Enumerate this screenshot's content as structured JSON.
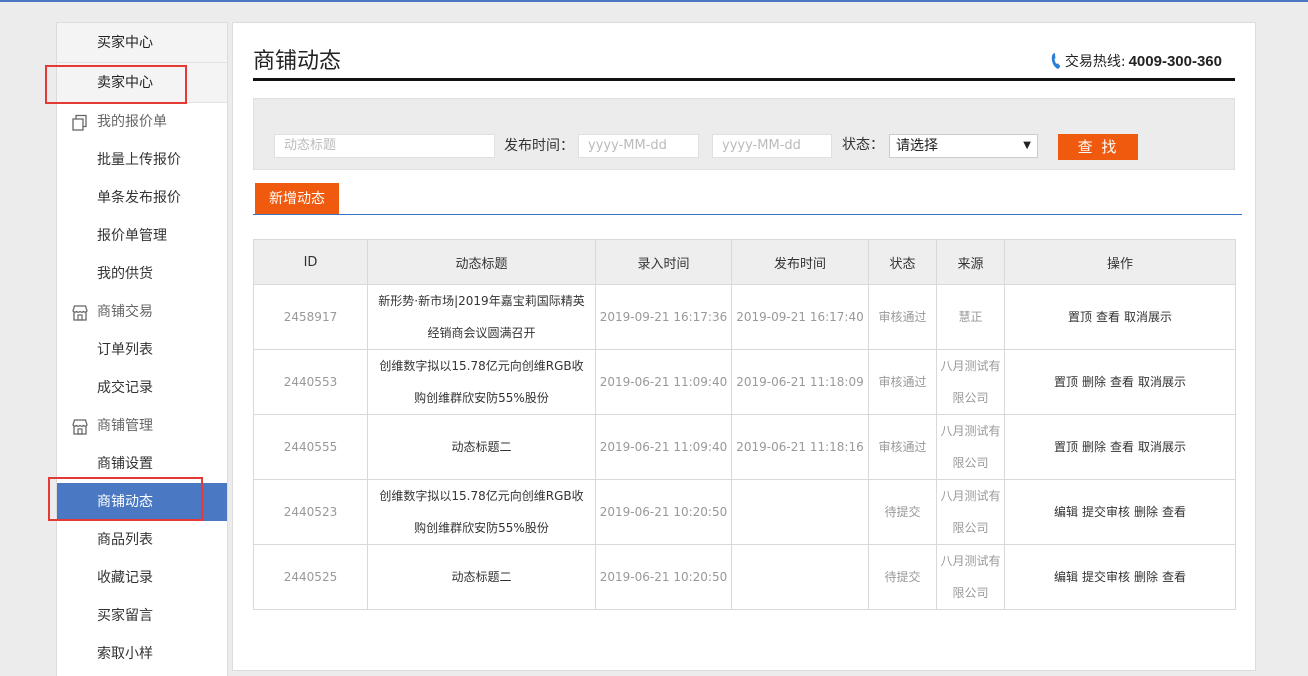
{
  "sidebar": {
    "buyer_center": "买家中心",
    "seller_center": "卖家中心",
    "groups": [
      {
        "label": "我的报价单",
        "icon": "copy-icon",
        "items": [
          "批量上传报价",
          "单条发布报价",
          "报价单管理",
          "我的供货"
        ]
      },
      {
        "label": "商铺交易",
        "icon": "shop-icon",
        "items": [
          "订单列表",
          "成交记录"
        ]
      },
      {
        "label": "商铺管理",
        "icon": "shop-icon",
        "items": [
          "商铺设置",
          "商铺动态",
          "商品列表",
          "收藏记录",
          "买家留言",
          "索取小样"
        ]
      }
    ],
    "active_item": "商铺动态"
  },
  "header": {
    "title": "商铺动态",
    "hotline_label": "交易热线:",
    "hotline_number": "4009-300-360"
  },
  "search": {
    "title_placeholder": "动态标题",
    "publish_time_label": "发布时间：",
    "date_from_placeholder": "yyyy-MM-dd",
    "date_to_placeholder": "yyyy-MM-dd",
    "status_label": "状态：",
    "status_value": "请选择",
    "search_button": "查 找"
  },
  "add_button": "新增动态",
  "table": {
    "headers": [
      "ID",
      "动态标题",
      "录入时间",
      "发布时间",
      "状态",
      "来源",
      "操作"
    ],
    "rows": [
      {
        "id": "2458917",
        "title": "新形势·新市场|2019年嘉宝莉国际精英经销商会议圆满召开",
        "entered": "2019-09-21 16:17:36",
        "published": "2019-09-21 16:17:40",
        "status": "审核通过",
        "source": "慧正",
        "ops": [
          "置顶",
          "查看",
          "取消展示"
        ]
      },
      {
        "id": "2440553",
        "title": "创维数字拟以15.78亿元向创维RGB收购创维群欣安防55%股份",
        "entered": "2019-06-21 11:09:40",
        "published": "2019-06-21 11:18:09",
        "status": "审核通过",
        "source": "八月测试有限公司",
        "ops": [
          "置顶",
          "删除",
          "查看",
          "取消展示"
        ]
      },
      {
        "id": "2440555",
        "title": "动态标题二",
        "entered": "2019-06-21 11:09:40",
        "published": "2019-06-21 11:18:16",
        "status": "审核通过",
        "source": "八月测试有限公司",
        "ops": [
          "置顶",
          "删除",
          "查看",
          "取消展示"
        ]
      },
      {
        "id": "2440523",
        "title": "创维数字拟以15.78亿元向创维RGB收购创维群欣安防55%股份",
        "entered": "2019-06-21 10:20:50",
        "published": "",
        "status": "待提交",
        "source": "八月测试有限公司",
        "ops": [
          "编辑",
          "提交审核",
          "删除",
          "查看"
        ]
      },
      {
        "id": "2440525",
        "title": "动态标题二",
        "entered": "2019-06-21 10:20:50",
        "published": "",
        "status": "待提交",
        "source": "八月测试有限公司",
        "ops": [
          "编辑",
          "提交审核",
          "删除",
          "查看"
        ]
      }
    ]
  },
  "colors": {
    "accent": "#f05a0e",
    "active": "#4a78c2",
    "highlight": "#e53935"
  }
}
